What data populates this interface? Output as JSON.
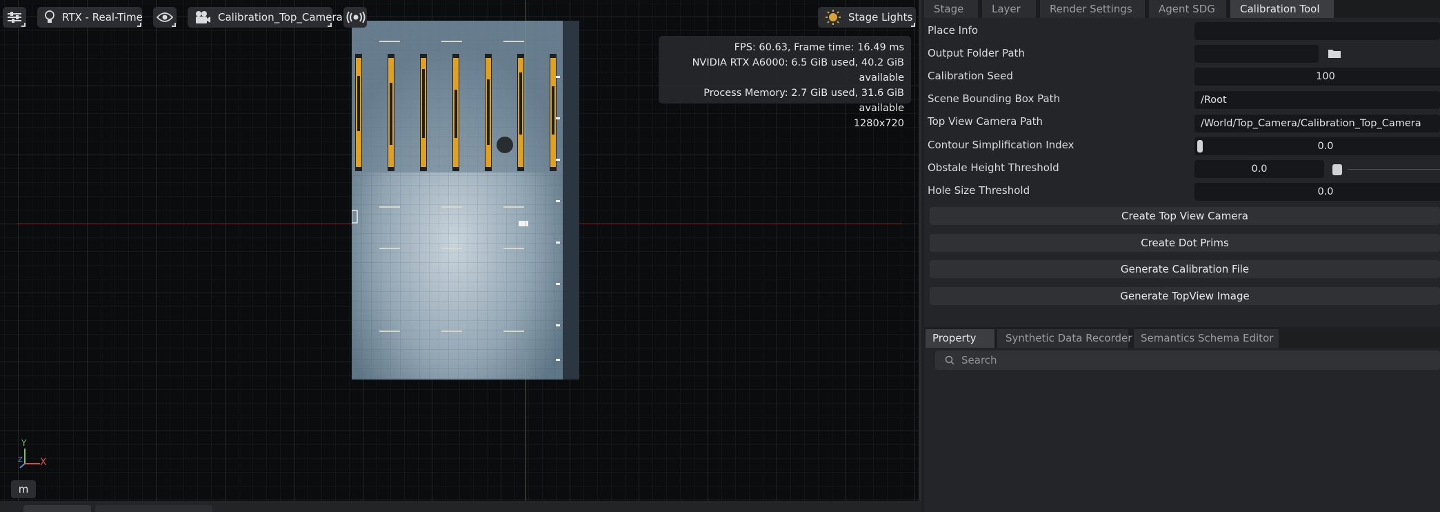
{
  "viewport": {
    "toolbar": {
      "renderer_label": "RTX - Real-Time",
      "camera_label": "Calibration_Top_Camera",
      "lights_label": "Stage Lights"
    },
    "stats": {
      "line1": "FPS: 60.63, Frame time: 16.49 ms",
      "line2": "NVIDIA RTX A6000: 6.5 GiB used, 40.2 GiB available",
      "line3": "Process Memory: 2.7 GiB used, 31.6 GiB available",
      "line4": "1280x720"
    },
    "gizmo": {
      "y_label": "Y",
      "x_label": "X",
      "z_label": "Z"
    },
    "m_button": "m"
  },
  "panel": {
    "tabs": [
      {
        "label": "Stage"
      },
      {
        "label": "Layer"
      },
      {
        "label": "Render Settings"
      },
      {
        "label": "Agent SDG"
      },
      {
        "label": "Calibration Tool"
      }
    ],
    "fields": {
      "place_info": {
        "label": "Place Info",
        "value": ""
      },
      "output_folder": {
        "label": "Output Folder Path",
        "value": ""
      },
      "calibration_seed": {
        "label": "Calibration Seed",
        "value": "100"
      },
      "bbox_path": {
        "label": "Scene Bounding Box Path",
        "value": "/Root"
      },
      "camera_path": {
        "label": "Top View Camera Path",
        "value": "/World/Top_Camera/Calibration_Top_Camera"
      },
      "contour_index": {
        "label": "Contour Simplification Index",
        "value": "0.0"
      },
      "obstacle_height": {
        "label": "Obstale Height Threshold",
        "value": "0.0"
      },
      "hole_size": {
        "label": "Hole Size Threshold",
        "value": "0.0"
      }
    },
    "buttons": {
      "create_camera": "Create Top View Camera",
      "create_dots": "Create Dot Prims",
      "generate_calibration": "Generate Calibration File",
      "generate_topview": "Generate TopView Image"
    },
    "lower_tabs": [
      {
        "label": "Property"
      },
      {
        "label": "Synthetic Data Recorder"
      },
      {
        "label": "Semantics Schema Editor"
      }
    ],
    "search_placeholder": "Search"
  }
}
